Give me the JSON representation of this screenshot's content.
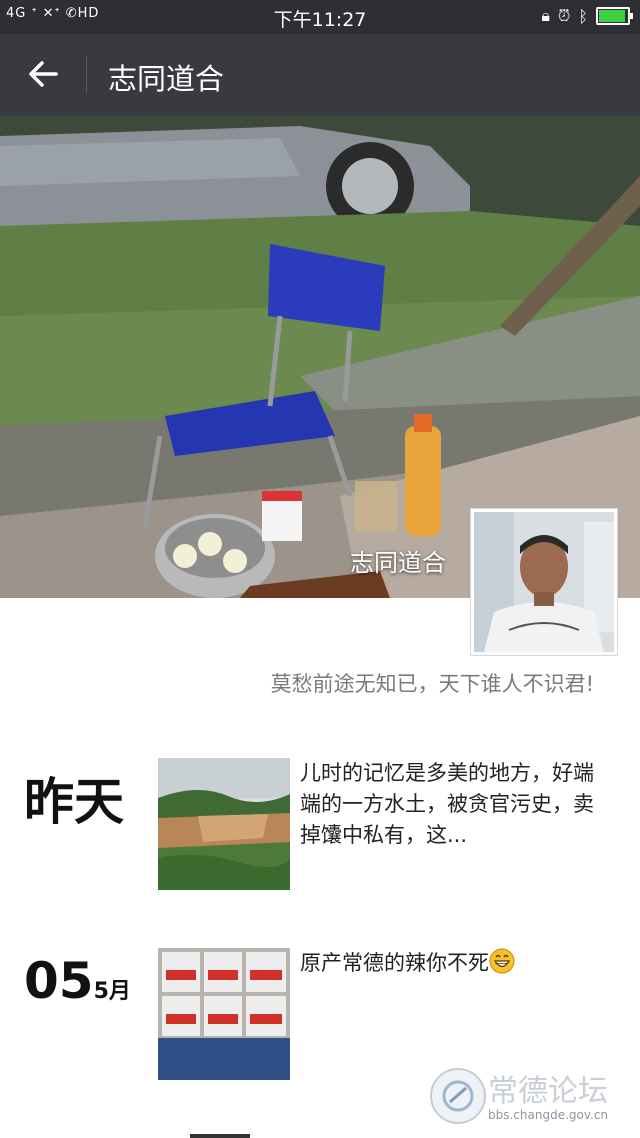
{
  "status_bar": {
    "left_indicators": "4G ᐩ  ✕ᐩ ✆HD",
    "time": "下午11:27",
    "icons": [
      "lock-rotation-icon",
      "alarm-icon",
      "bluetooth-icon",
      "battery-charging-icon"
    ],
    "battery_level": 0.85,
    "battery_color": "#3fd13f"
  },
  "nav": {
    "back_icon": "back-arrow-icon",
    "title": "志同道合"
  },
  "profile": {
    "cover_name": "志同道合",
    "signature": "莫愁前途无知已，天下谁人不识君!"
  },
  "posts": [
    {
      "date_label": "昨天",
      "text": "儿时的记忆是多美的地方，好端端的一方水土，被贪官污史，卖掉馕中私有，这..."
    },
    {
      "date_day": "05",
      "date_month": "5月",
      "text": "原产常德的辣你不死",
      "emoji": "grinning-face-icon"
    }
  ],
  "watermark": {
    "title": "常德论坛",
    "url": "bbs.changde.gov.cn"
  }
}
